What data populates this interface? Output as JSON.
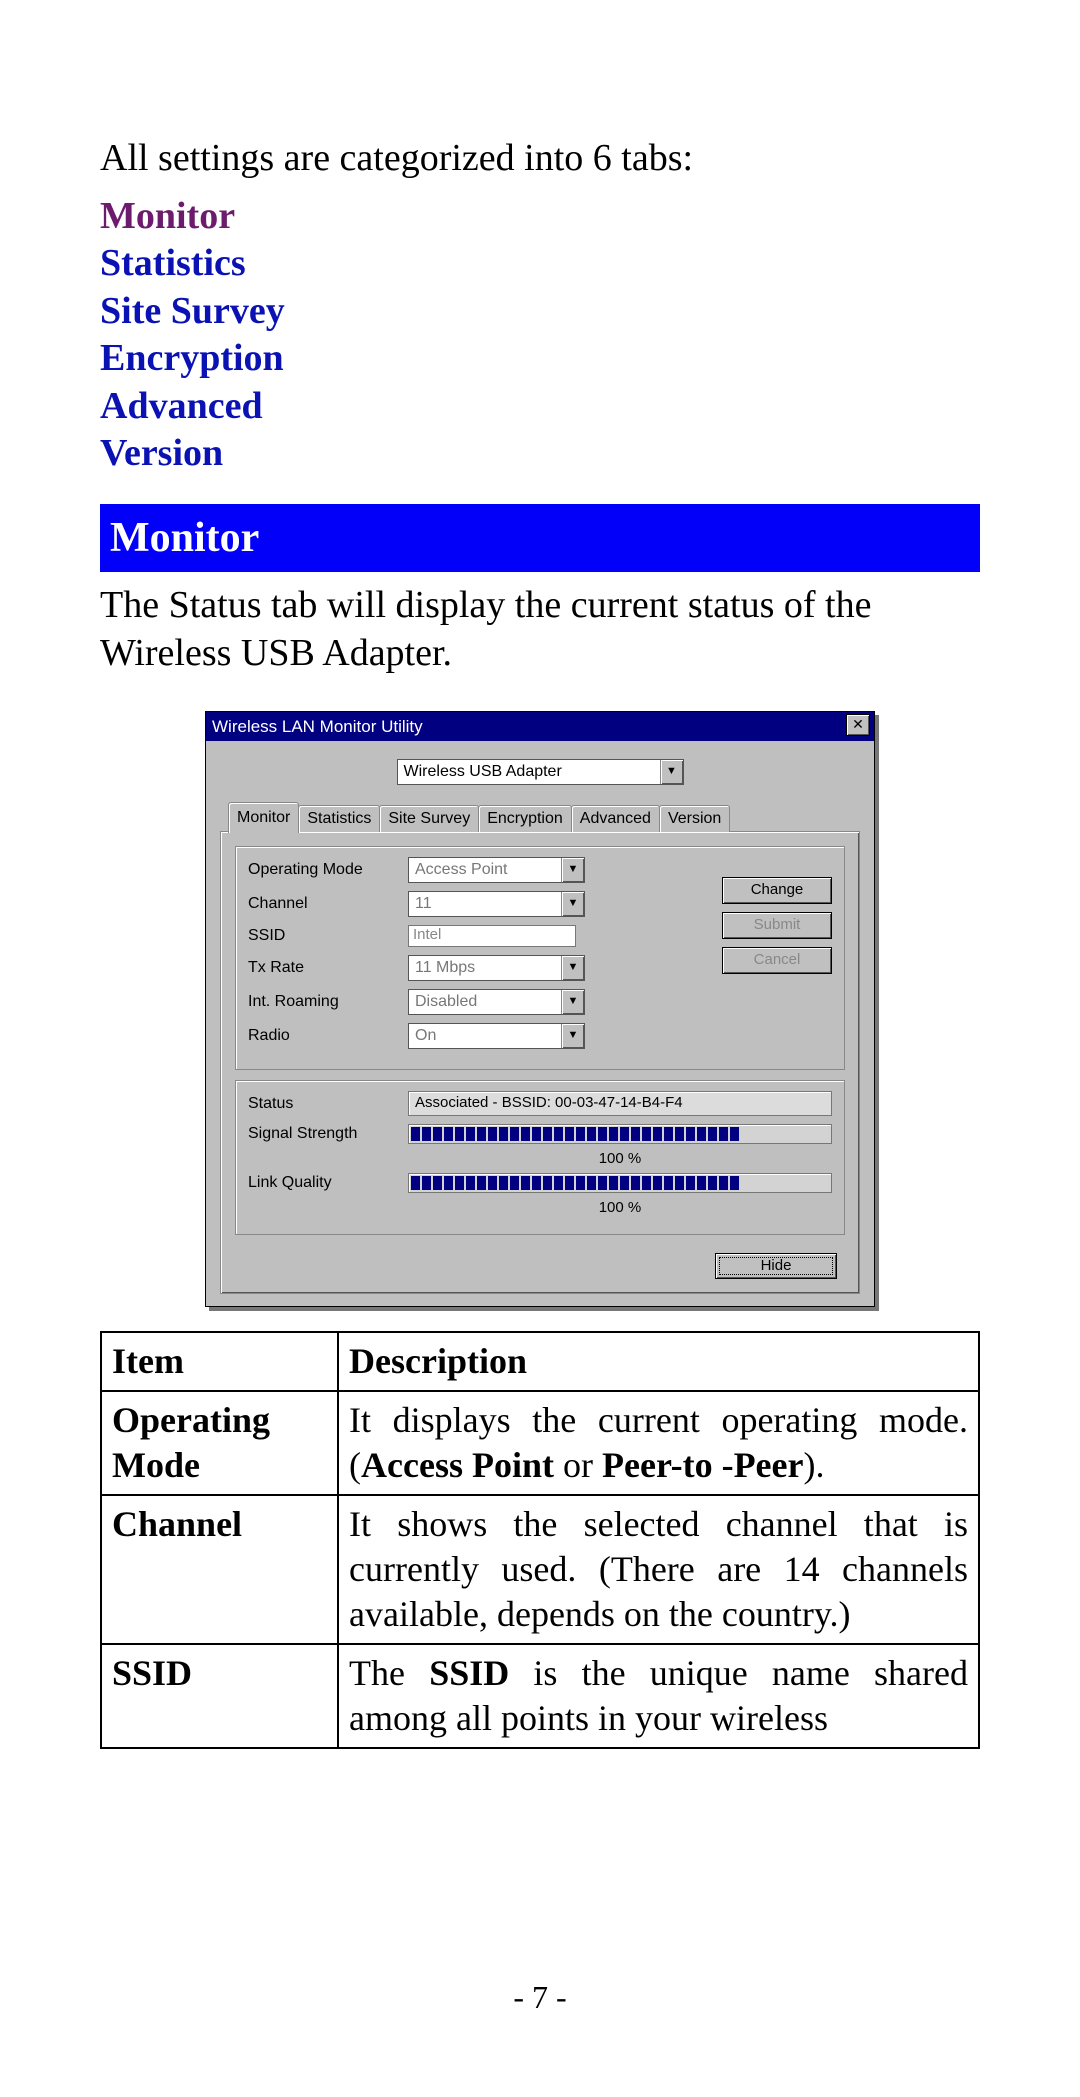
{
  "intro": "All settings are categorized into 6 tabs:",
  "tab_links": {
    "monitor": "Monitor",
    "statistics": "Statistics",
    "site_survey": "Site Survey",
    "encryption": "Encryption",
    "advanced": "Advanced",
    "version": "Version"
  },
  "section_header": "Monitor",
  "section_text": "The Status tab will display the current status of the Wireless USB Adapter.",
  "dialog": {
    "title": "Wireless LAN Monitor Utility",
    "close_glyph": "✕",
    "adapter_selected": "Wireless USB Adapter",
    "tabs": [
      "Monitor",
      "Statistics",
      "Site Survey",
      "Encryption",
      "Advanced",
      "Version"
    ],
    "active_tab_index": 0,
    "fields": {
      "operating_mode_label": "Operating Mode",
      "operating_mode_value": "Access Point",
      "channel_label": "Channel",
      "channel_value": "11",
      "ssid_label": "SSID",
      "ssid_value": "Intel",
      "tx_rate_label": "Tx Rate",
      "tx_rate_value": "11 Mbps",
      "int_roaming_label": "Int. Roaming",
      "int_roaming_value": "Disabled",
      "radio_label": "Radio",
      "radio_value": "On"
    },
    "buttons": {
      "change": "Change",
      "submit": "Submit",
      "cancel": "Cancel",
      "hide": "Hide"
    },
    "status": {
      "status_label": "Status",
      "status_value": "Associated - BSSID: 00-03-47-14-B4-F4",
      "signal_label": "Signal Strength",
      "signal_percent": "100 %",
      "link_label": "Link Quality",
      "link_percent": "100 %"
    }
  },
  "table": {
    "header_item": "Item",
    "header_desc": "Description",
    "r1_item": "Operating Mode",
    "r1_a": "It displays the current operating mode. (",
    "r1_b": "Access Point",
    "r1_c": " or ",
    "r1_d": "Peer-to -Peer",
    "r1_e": ").",
    "r2_item": "Channel",
    "r2_desc": "It shows the selected channel that is currently used. (There are 14 channels available, depends on the country.)",
    "r3_item": "SSID",
    "r3_a": "The ",
    "r3_b": "SSID",
    "r3_c": " is the unique name shared among all points in your wireless"
  },
  "page_number": "- 7 -"
}
